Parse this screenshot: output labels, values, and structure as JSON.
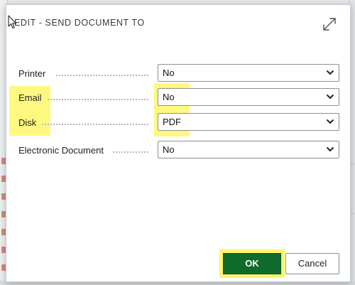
{
  "dialog": {
    "title": "EDIT - SEND DOCUMENT TO",
    "expand_icon": "expand-diagonal-arrows-icon",
    "cursor_icon": "mouse-pointer-icon"
  },
  "fields": [
    {
      "label": "Printer",
      "value": "No",
      "highlighted": false
    },
    {
      "label": "Email",
      "value": "No",
      "highlighted": true
    },
    {
      "label": "Disk",
      "value": "PDF",
      "highlighted": true
    },
    {
      "label": "Electronic Document",
      "value": "No",
      "highlighted": false
    }
  ],
  "buttons": {
    "ok_label": "OK",
    "cancel_label": "Cancel"
  },
  "colors": {
    "ok_button": "#0f6b2c",
    "highlight": "#fff76a",
    "active_border": "#2f6fa6"
  }
}
